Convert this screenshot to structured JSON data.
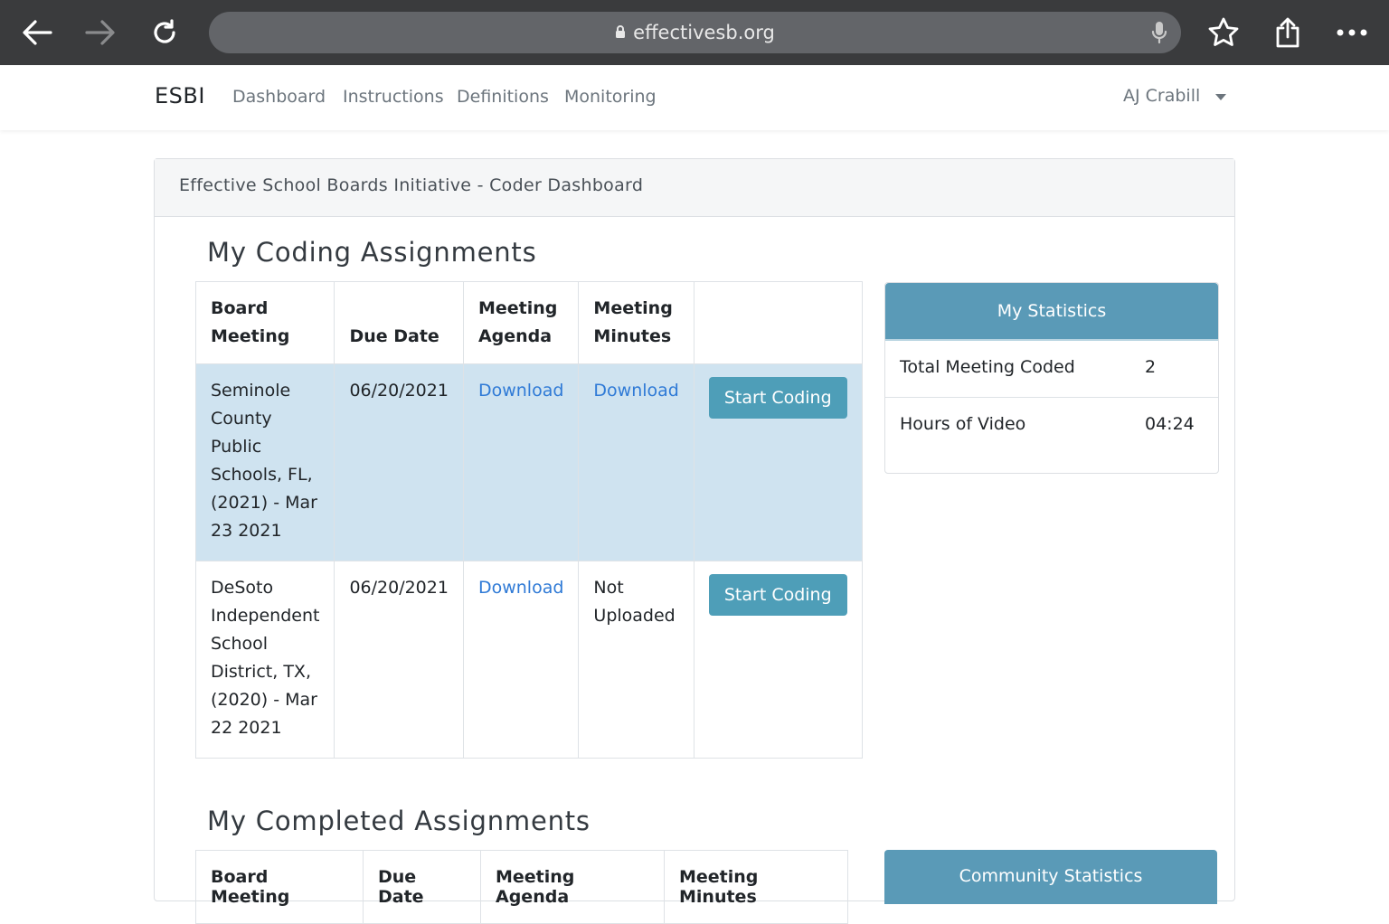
{
  "browser": {
    "url": "effectivesb.org",
    "icons": [
      "back-arrow-icon",
      "forward-arrow-icon",
      "reload-icon",
      "lock-icon",
      "microphone-icon",
      "star-icon",
      "share-icon",
      "more-icon"
    ]
  },
  "navbar": {
    "brand": "ESBI",
    "links": [
      "Dashboard",
      "Instructions",
      "Definitions",
      "Monitoring"
    ],
    "user": "AJ Crabill"
  },
  "card": {
    "header": "Effective School Boards Initiative - Coder Dashboard"
  },
  "coding": {
    "title": "My Coding Assignments",
    "columns": [
      "Board Meeting",
      "Due Date",
      "Meeting Agenda",
      "Meeting Minutes",
      ""
    ],
    "rows": [
      {
        "board_meeting": "Seminole County Public Schools, FL, (2021) - Mar 23 2021",
        "due_date": "06/20/2021",
        "agenda": "Download",
        "minutes": "Download",
        "action": "Start Coding",
        "highlighted": true
      },
      {
        "board_meeting": "DeSoto Independent School District, TX, (2020) - Mar 22 2021",
        "due_date": "06/20/2021",
        "agenda": "Download",
        "minutes": "Not Uploaded",
        "action": "Start Coding",
        "highlighted": false
      }
    ]
  },
  "stats": {
    "title": "My Statistics",
    "items": [
      {
        "label": "Total Meeting Coded",
        "value": "2"
      },
      {
        "label": "Hours of Video",
        "value": "04:24"
      }
    ]
  },
  "completed": {
    "title": "My Completed Assignments",
    "columns": [
      "Board Meeting",
      "Due Date",
      "Meeting Agenda",
      "Meeting Minutes"
    ]
  },
  "community": {
    "title": "Community Statistics"
  },
  "colors": {
    "accent": "#4e9eb8",
    "stats_header": "#5a9ab7",
    "row_highlight": "#cfe3f0",
    "link": "#2f7ad6",
    "chrome": "#3a3b3d"
  }
}
